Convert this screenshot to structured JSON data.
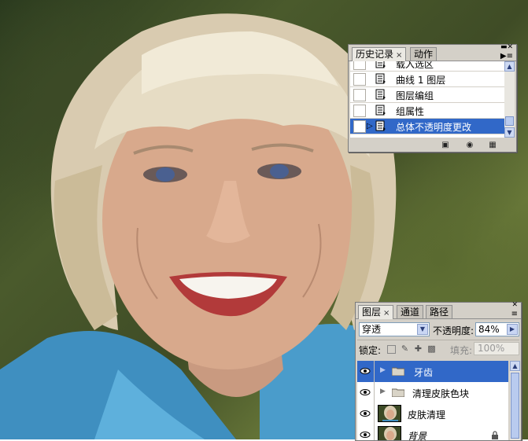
{
  "history_panel": {
    "tabs": [
      {
        "label": "历史记录",
        "close": "×"
      },
      {
        "label": "动作"
      }
    ],
    "items": [
      {
        "label": "载入选区"
      },
      {
        "label": "曲线 1 图层"
      },
      {
        "label": "图层编组"
      },
      {
        "label": "组属性"
      },
      {
        "label": "总体不透明度更改",
        "selected": true
      }
    ],
    "footer_icons": [
      "new-document-from-state-icon",
      "camera-snapshot-icon",
      "trash-icon"
    ]
  },
  "layers_panel": {
    "tabs": [
      {
        "label": "图层",
        "close": "×"
      },
      {
        "label": "通道"
      },
      {
        "label": "路径"
      }
    ],
    "blend_mode": "穿透",
    "opacity_label": "不透明度:",
    "opacity_value": "84%",
    "lock_label": "锁定:",
    "fill_label": "填充:",
    "fill_value": "100%",
    "layers": [
      {
        "name": "牙齿",
        "type": "group",
        "selected": true
      },
      {
        "name": "清理皮肤色块",
        "type": "group"
      },
      {
        "name": "皮肤清理",
        "type": "layer"
      },
      {
        "name": "背景",
        "type": "background",
        "locked": true
      }
    ]
  },
  "colors": {
    "selection": "#3168c8",
    "panel_bg": "#d4d0c8"
  }
}
